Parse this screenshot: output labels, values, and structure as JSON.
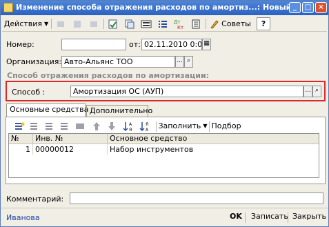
{
  "window": {
    "title": "Изменение способа отражения расходов по амортиз...: Новый *"
  },
  "toolbar": {
    "actions_label": "Действия",
    "fill_label": "Заполнить",
    "advice_label": "Советы",
    "help_label": "?"
  },
  "form": {
    "number_label": "Номер:",
    "number_value": "",
    "from_label": "от:",
    "date_value": "02.11.2010 0:00:00",
    "org_label": "Организация:",
    "org_value": "Авто-Альянс ТОО",
    "section_title": "Способ отражения расходов по амортизации:",
    "method_label": "Способ :",
    "method_value": "Амортизация ОС (АУП)",
    "comment_label": "Комментарий:",
    "comment_value": ""
  },
  "tabs": [
    {
      "label": "Основные средства"
    },
    {
      "label": "Дополнительно"
    }
  ],
  "table_toolbar": {
    "fill_label": "Заполнить",
    "select_label": "Подбор"
  },
  "table": {
    "headers": [
      "№",
      "Инв. №",
      "Основное средство"
    ],
    "rows": [
      {
        "n": "1",
        "inv": "00000012",
        "asset": "Набор инструментов"
      }
    ]
  },
  "status": {
    "user": "Иванова"
  },
  "buttons": {
    "ok": "OK",
    "save": "Записать",
    "close": "Закрыть"
  }
}
